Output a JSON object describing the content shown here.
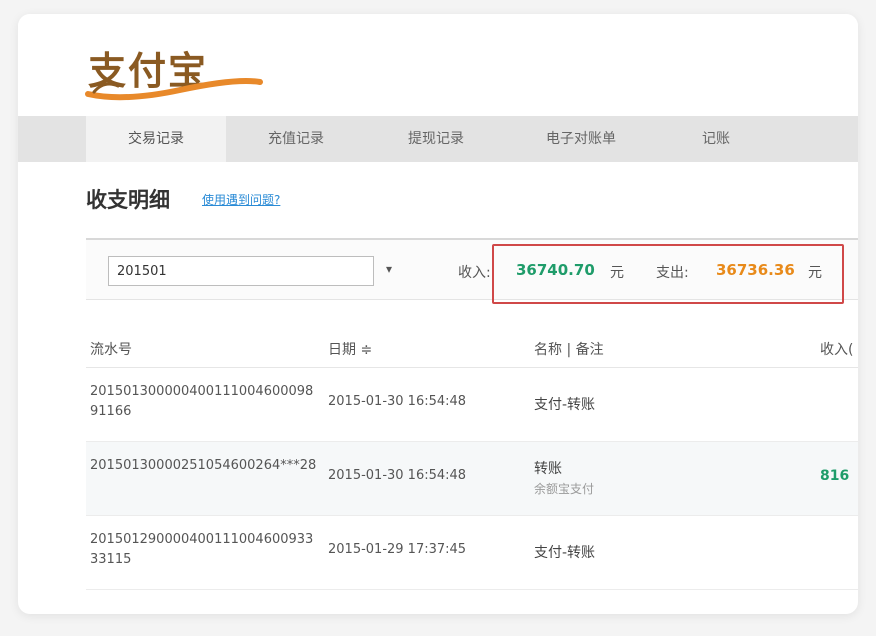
{
  "logo": {
    "text": "支付宝"
  },
  "nav": {
    "tabs": [
      {
        "label": "交易记录"
      },
      {
        "label": "充值记录"
      },
      {
        "label": "提现记录"
      },
      {
        "label": "电子对账单"
      },
      {
        "label": "记账"
      }
    ]
  },
  "page": {
    "title": "收支明细",
    "help_link": "使用遇到问题?"
  },
  "filter": {
    "month_value": "201501",
    "dropdown_icon": "▾",
    "income_label": "收入:",
    "income_value": "36740.70",
    "income_unit": "元",
    "expense_label": "支出:",
    "expense_value": "36736.36",
    "expense_unit": "元"
  },
  "table": {
    "headers": {
      "serial": "流水号",
      "date": "日期",
      "date_sort_icon": "≑",
      "name": "名称 | 备注",
      "income": "收入("
    },
    "rows": [
      {
        "serial": "20150130000040011100460009891166",
        "date": "2015-01-30 16:54:48",
        "name": "支付-转账",
        "sub": "",
        "income": ""
      },
      {
        "serial": "20150130000251054600264***28",
        "date": "2015-01-30 16:54:48",
        "name": "转账",
        "sub": "余额宝支付",
        "income": "816"
      },
      {
        "serial": "20150129000040011100460093333115",
        "date": "2015-01-29 17:37:45",
        "name": "支付-转账",
        "sub": "",
        "income": ""
      },
      {
        "serial": "",
        "date": "",
        "name": "",
        "sub": "",
        "income": ""
      }
    ]
  },
  "colors": {
    "income_green": "#1f9c6a",
    "expense_orange": "#e88a1a",
    "highlight_red": "#d04848",
    "nav_bg": "#e3e3e3"
  }
}
